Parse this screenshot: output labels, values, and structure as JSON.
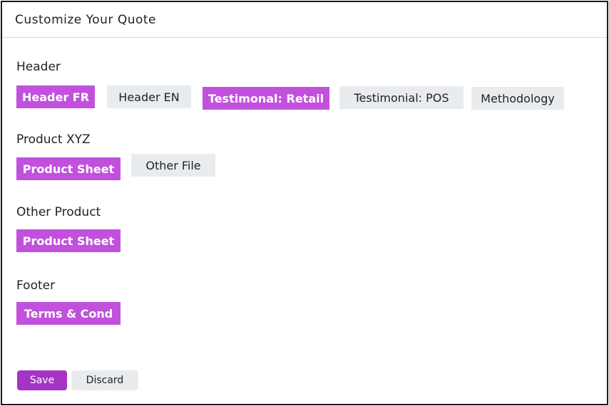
{
  "header": {
    "title": "Customize Your Quote"
  },
  "sections": [
    {
      "label": "Header",
      "items": [
        {
          "label": "Header FR",
          "selected": true
        },
        {
          "label": "Header EN",
          "selected": false
        },
        {
          "label": "Testimonal: Retail",
          "selected": true
        },
        {
          "label": "Testimonial: POS",
          "selected": false
        },
        {
          "label": "Methodology",
          "selected": false
        }
      ]
    },
    {
      "label": "Product XYZ",
      "items": [
        {
          "label": "Product Sheet",
          "selected": true
        },
        {
          "label": "Other File",
          "selected": false
        }
      ]
    },
    {
      "label": "Other Product",
      "items": [
        {
          "label": "Product Sheet",
          "selected": true
        }
      ]
    },
    {
      "label": "Footer",
      "items": [
        {
          "label": "Terms & Cond",
          "selected": true
        }
      ]
    }
  ],
  "actions": {
    "save_label": "Save",
    "discard_label": "Discard"
  },
  "colors": {
    "selected": "#c151dc",
    "unselected": "#e9ecef",
    "save_button": "#a533c4",
    "divider": "#d4d8dc"
  }
}
